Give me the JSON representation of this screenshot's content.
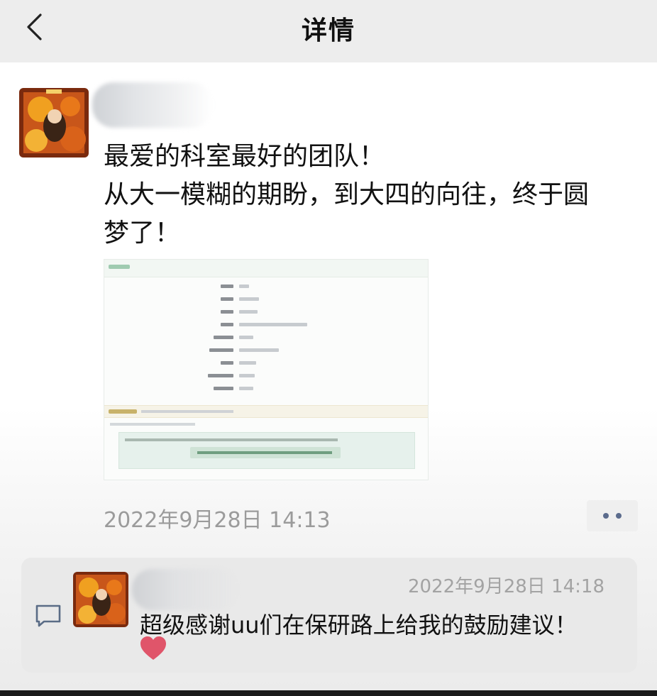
{
  "header": {
    "back_icon": "chevron-left-icon",
    "title": "详情"
  },
  "post": {
    "lines": [
      "最爱的科室最好的团队！",
      "从大一模糊的期盼，到大四的向往，终于圆",
      "梦了！"
    ],
    "timestamp": "2022年9月28日 14:13",
    "more_icon": "more-dots-icon"
  },
  "comment": {
    "icon": "comment-icon",
    "timestamp": "2022年9月28日 14:18",
    "text": "超级感谢uu们在保研路上给我的鼓励建议！",
    "emoji": "heart-icon"
  },
  "colors": {
    "header_bg": "#ededed",
    "comment_bg": "#e9e9e9",
    "more_dots": "#5b6b8c",
    "heart": "#e0556a"
  }
}
